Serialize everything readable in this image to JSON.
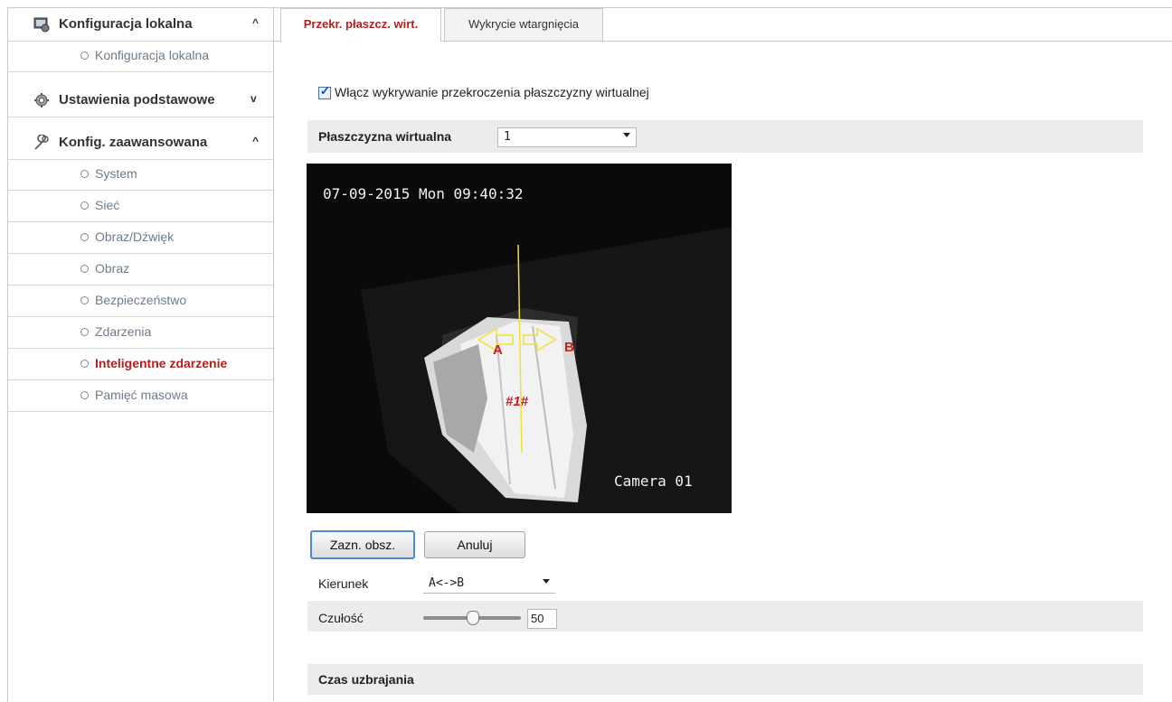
{
  "sidebar": {
    "sections": [
      {
        "label": "Konfiguracja lokalna",
        "icon": "local-config-icon",
        "chevron": "^",
        "items": [
          "Konfiguracja lokalna"
        ]
      },
      {
        "label": "Ustawienia podstawowe",
        "icon": "gear-icon",
        "chevron": "v",
        "items": []
      },
      {
        "label": "Konfig. zaawansowana",
        "icon": "wrench-icon",
        "chevron": "^",
        "items": [
          "System",
          "Sieć",
          "Obraz/Dźwięk",
          "Obraz",
          "Bezpieczeństwo",
          "Zdarzenia",
          "Inteligentne zdarzenie",
          "Pamięć masowa"
        ]
      }
    ],
    "active_item": "Inteligentne zdarzenie"
  },
  "tabs": [
    {
      "label": "Przekr. płaszcz. wirt.",
      "active": true
    },
    {
      "label": "Wykrycie wtargnięcia",
      "active": false
    }
  ],
  "enable_checkbox": {
    "label": "Włącz wykrywanie przekroczenia płaszczyzny wirtualnej",
    "checked": true
  },
  "virtual_plane": {
    "label": "Płaszczyzna wirtualna",
    "value": "1"
  },
  "video": {
    "timestamp": "07-09-2015 Mon 09:40:32",
    "camera_name": "Camera 01",
    "line_label": "#1#",
    "side_a": "A",
    "side_b": "B"
  },
  "buttons": {
    "draw_area": "Zazn. obsz.",
    "cancel": "Anuluj"
  },
  "direction": {
    "label": "Kierunek",
    "value": "A<->B"
  },
  "sensitivity": {
    "label": "Czułość",
    "value": "50",
    "level": 0.5
  },
  "arming_time": {
    "label": "Czas uzbrajania"
  },
  "colors": {
    "accent_red": "#b21f1f",
    "line_yellow": "#f0e03c",
    "band_gray": "#ececec"
  }
}
